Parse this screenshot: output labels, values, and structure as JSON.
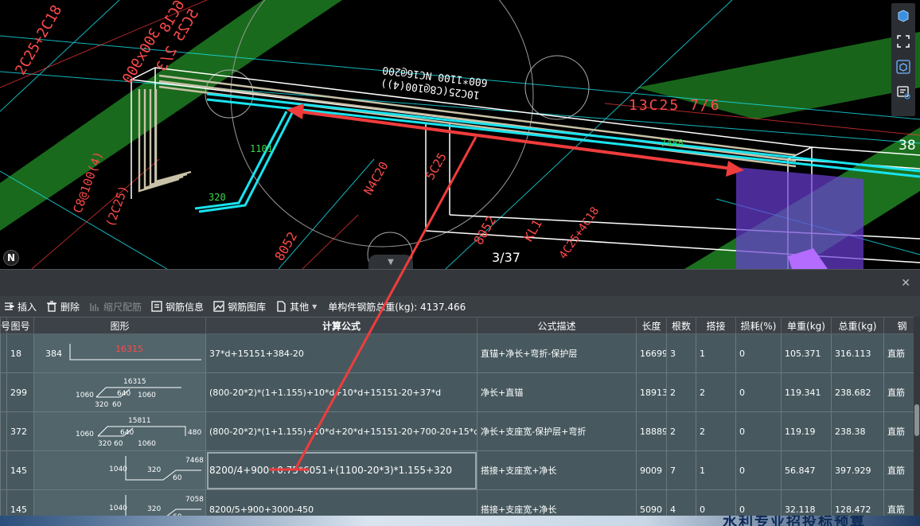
{
  "viewport": {
    "cad_labels": {
      "beam_spec_1": "600*1100 NC16@200",
      "beam_spec_2": "10C25(C8@100(4))",
      "rebar_label_1": "13C25 7/6",
      "len_1101": "1101",
      "len_320": "320",
      "len_7488": "7488",
      "top_left_a": "2C25+2C18",
      "top_left_b": "300x900",
      "top_left_c": "5C25 2/3",
      "top_left_d": "6C18",
      "left_vertical_1": "C8@100(4)",
      "left_vertical_2": "(2C25)",
      "mid_text_1": "N4C20",
      "mid_text_2": "5C25",
      "bottom_text_1": "8052",
      "bottom_text_2": "8052",
      "bottom_text_3": "KL1",
      "bottom_right_1": "4C25+4C18"
    },
    "page_indicator": "3/37",
    "edge_number": "38",
    "compass": "N"
  },
  "toolbar": {
    "insert": "插入",
    "delete": "删除",
    "shrink": "缩尺配筋",
    "rebar_info": "钢筋信息",
    "rebar_library": "钢筋图库",
    "other": "其他",
    "total_label": "单构件钢筋总重(kg): 4137.466"
  },
  "table": {
    "headers": [
      "号",
      "图号",
      "图形",
      "计算公式",
      "公式描述",
      "长度",
      "根数",
      "搭接",
      "损耗(%)",
      "单重(kg)",
      "总重(kg)",
      "钢"
    ],
    "rows": [
      {
        "no": "",
        "fig": "18",
        "shape": {
          "left": "384",
          "mid": "16315"
        },
        "formula": "37*d+15151+384-20",
        "desc": "直锚+净长+弯折-保护层",
        "length": "16699",
        "count": "3",
        "lap": "1",
        "loss": "0",
        "unit_w": "105.371",
        "total_w": "316.113",
        "type": "直筋"
      },
      {
        "no": "",
        "fig": "299",
        "shape": {
          "top": "16315",
          "a": "1060",
          "b": "640",
          "c": "1060",
          "d": "320",
          "e": "60"
        },
        "formula": "(800-20*2)*(1+1.155)+10*d+10*d+15151-20+37*d",
        "desc": "净长+直锚",
        "length": "18913",
        "count": "2",
        "lap": "2",
        "loss": "0",
        "unit_w": "119.341",
        "total_w": "238.682",
        "type": "直筋"
      },
      {
        "no": "",
        "fig": "372",
        "shape": {
          "top": "15811",
          "a": "1060",
          "b": "640",
          "c": "1060",
          "d": "320",
          "e": "60",
          "f": "480"
        },
        "formula": "(800-20*2)*(1+1.155)+10*d+20*d+15151-20+700-20+15*d",
        "desc": "净长+支座宽-保护层+弯折",
        "length": "18889",
        "count": "2",
        "lap": "2",
        "loss": "0",
        "unit_w": "119.19",
        "total_w": "238.38",
        "type": "直筋"
      },
      {
        "no": "",
        "fig": "145",
        "shape": {
          "top": "7468",
          "a": "1040",
          "b": "320",
          "c": "60"
        },
        "formula": "8200/4+900+0.75*6051+(1100-20*3)*1.155+320",
        "desc": "搭接+支座宽+净长",
        "length": "9009",
        "count": "7",
        "lap": "1",
        "loss": "0",
        "unit_w": "56.847",
        "total_w": "397.929",
        "type": "直筋"
      },
      {
        "no": "",
        "fig": "145",
        "shape": {
          "top": "7058",
          "a": "1040",
          "b": "320",
          "c": "60"
        },
        "formula": "8200/5+900+3000-450",
        "desc": "搭接+支座宽+净长",
        "length": "5090",
        "count": "4",
        "lap": "0",
        "loss": "0",
        "unit_w": "32.118",
        "total_w": "128.472",
        "type": "直筋"
      }
    ]
  },
  "footer": {
    "banner_text": "水利专业招投标预算"
  },
  "colors": {
    "annotation_red": "#f03c3c",
    "panel_bg": "#3a3f44",
    "row_bg": "#47595f",
    "rebar_cyan": "#19e3ee",
    "green_band": "#1f7d22"
  }
}
